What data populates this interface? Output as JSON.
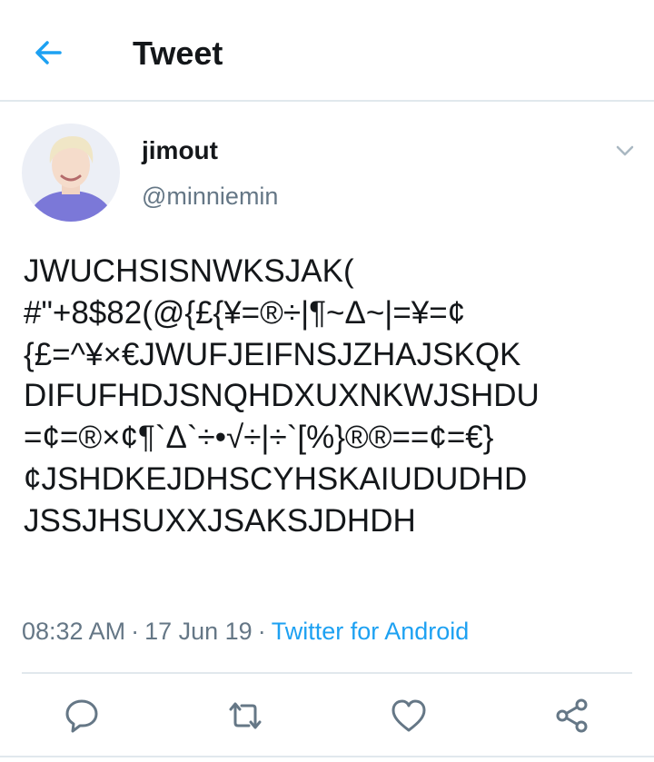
{
  "header": {
    "title": "Tweet",
    "back_icon": "back-arrow-icon",
    "accent": "#1da1f2"
  },
  "tweet": {
    "display_name": "jimout",
    "handle": "@minniemin",
    "text_lines": [
      "JWUCHSISNWKSJAK(",
      "#\"+8$82(@{£{¥=®÷|¶~Δ~|=¥=¢",
      "{£=^¥×€JWUFJEIFNSJZHAJSKQK",
      "DIFUFHDJSNQHDXUXNKWJSHDU",
      "=¢=®×¢¶`Δ`÷•√÷|÷`[%}®®==¢=€}",
      "¢JSHDKEJDHSCYHSKAIUDUDHD",
      "JSSJHSUXXJSAKSJDHDH"
    ],
    "time": "08:32 AM",
    "separator": "·",
    "date": "17 Jun 19",
    "source": "Twitter for Android"
  },
  "actions": {
    "reply_icon": "reply-icon",
    "retweet_icon": "retweet-icon",
    "like_icon": "heart-icon",
    "share_icon": "share-icon"
  },
  "colors": {
    "text": "#14171a",
    "secondary": "#657786",
    "link": "#1da1f2",
    "divider": "#e1e8ed",
    "icon": "#657786"
  }
}
